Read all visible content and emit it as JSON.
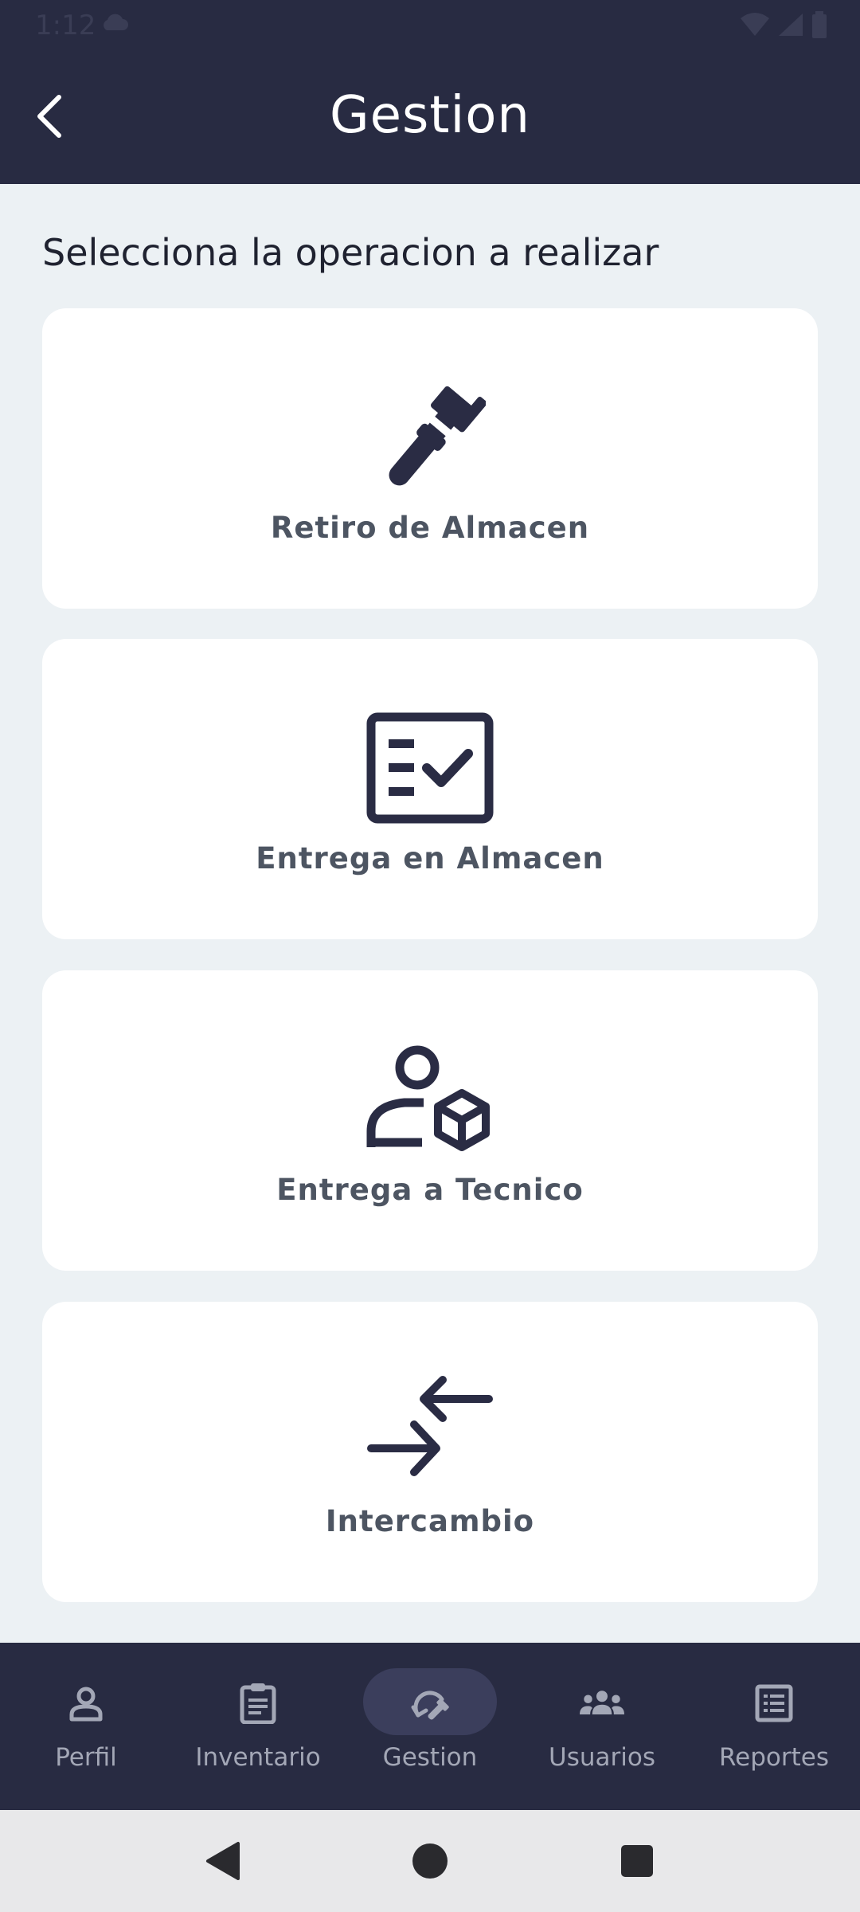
{
  "status_bar": {
    "time": "1:12"
  },
  "header": {
    "title": "Gestion",
    "back_icon": "chevron-left-icon"
  },
  "main": {
    "prompt": "Selecciona la operacion a realizar",
    "cards": [
      {
        "label": "Retiro de Almacen",
        "icon": "pipe-wrench-icon"
      },
      {
        "label": "Entrega en Almacen",
        "icon": "checklist-icon"
      },
      {
        "label": "Entrega a Tecnico",
        "icon": "person-package-icon"
      },
      {
        "label": "Intercambio",
        "icon": "exchange-arrows-icon"
      }
    ]
  },
  "bottom_nav": {
    "items": [
      {
        "label": "Perfil",
        "icon": "person-icon",
        "selected": false
      },
      {
        "label": "Inventario",
        "icon": "clipboard-icon",
        "selected": false
      },
      {
        "label": "Gestion",
        "icon": "manage-icon",
        "selected": true
      },
      {
        "label": "Usuarios",
        "icon": "group-icon",
        "selected": false
      },
      {
        "label": "Reportes",
        "icon": "report-icon",
        "selected": false
      }
    ]
  },
  "colors": {
    "header_bg": "#282B42",
    "content_bg": "#ECF1F4",
    "card_bg": "#FFFFFF",
    "icon_dark": "#2A2C44",
    "label_gray": "#4D5562",
    "nav_label": "#A3A7B6",
    "nav_pill": "#3B3E5C"
  }
}
